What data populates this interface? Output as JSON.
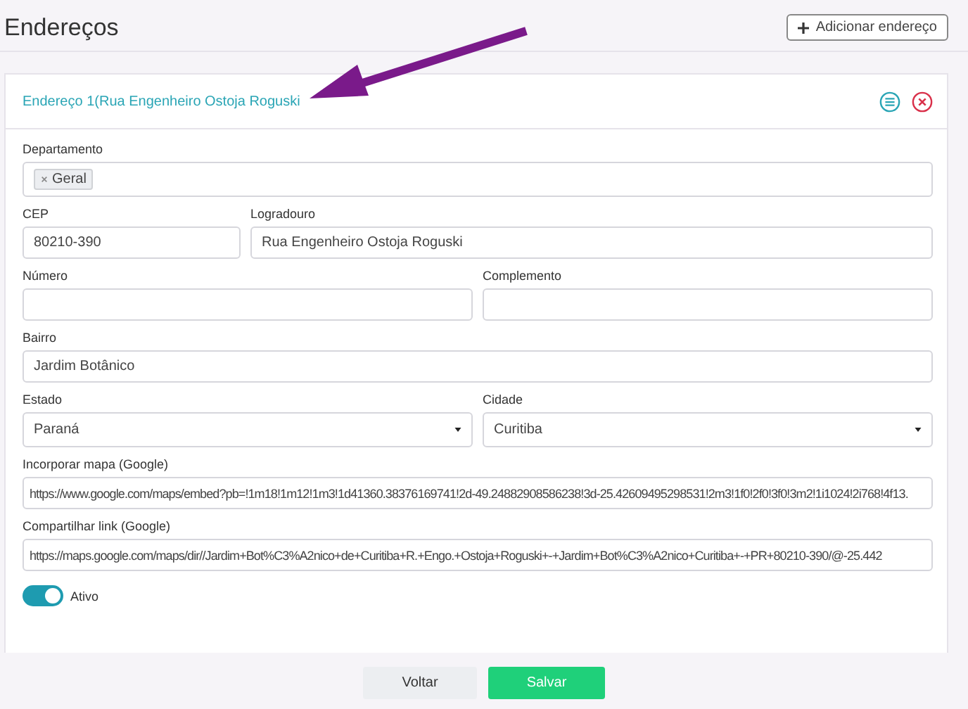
{
  "page_title": "Endereços",
  "add_button": {
    "label": "Adicionar endereço"
  },
  "card": {
    "title": "Endereço 1(Rua Engenheiro Ostoja Roguski",
    "rows": [
      [
        {
          "kind": "tags",
          "label": "Departamento",
          "tags": [
            "Geral"
          ]
        }
      ],
      [
        {
          "kind": "text",
          "label": "CEP",
          "value": "80210-390"
        },
        {
          "kind": "text",
          "label": "Logradouro",
          "value": "Rua Engenheiro Ostoja Roguski"
        }
      ],
      [
        {
          "kind": "text",
          "label": "Número"
        },
        {
          "kind": "text",
          "label": "Complemento"
        }
      ],
      [
        {
          "kind": "text",
          "label": "Bairro",
          "value": "Jardim Botânico"
        }
      ],
      [
        {
          "kind": "select",
          "label": "Estado",
          "value": "Paraná"
        },
        {
          "kind": "select",
          "label": "Cidade",
          "value": "Curitiba"
        }
      ],
      [
        {
          "kind": "text",
          "label": "Incorporar mapa (Google)",
          "value": "https://www.google.com/maps/embed?pb=!1m18!1m12!1m3!1d41360.38376169741!2d-49.24882908586238!3d-25.42609495298531!2m3!1f0!2f0!3f0!3m2!1i1024!2i768!4f13."
        }
      ],
      [
        {
          "kind": "text",
          "label": "Compartilhar link (Google)",
          "value": "https://maps.google.com/maps/dir//Jardim+Bot%C3%A2nico+de+Curitiba+R.+Engo.+Ostoja+Roguski+-+Jardim+Bot%C3%A2nico+Curitiba+-+PR+80210-390/@-25.442"
        }
      ]
    ],
    "toggle": {
      "label": "Ativo",
      "on": true
    }
  },
  "buttons": [
    {
      "kind": "secondary",
      "label": "Voltar"
    },
    {
      "kind": "primary",
      "label": "Salvar"
    }
  ]
}
